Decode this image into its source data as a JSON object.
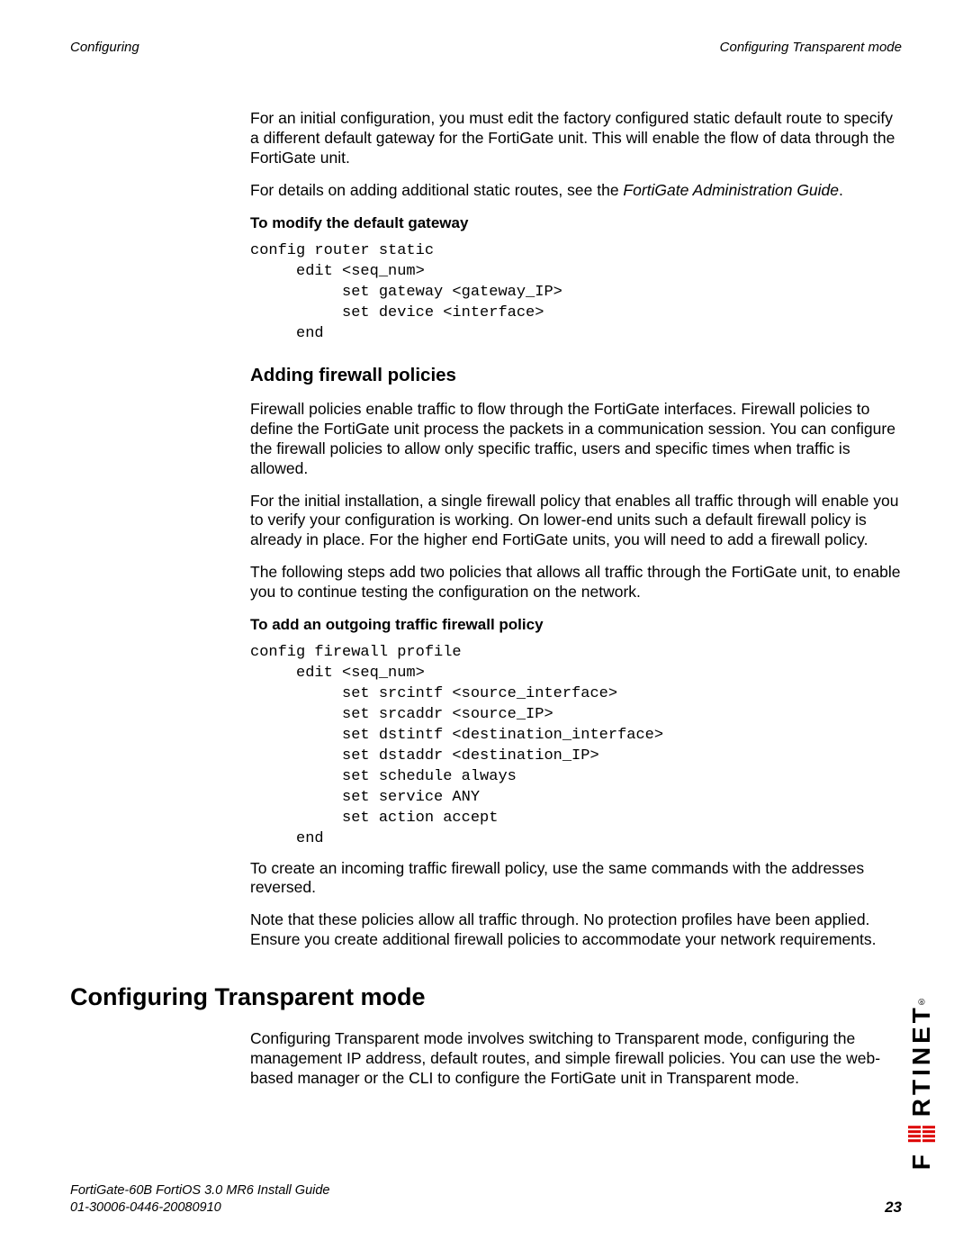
{
  "header": {
    "left": "Configuring",
    "right": "Configuring Transparent mode"
  },
  "intro": {
    "p1": "For an initial configuration, you must edit the factory configured static default route to specify a different default gateway for the FortiGate unit. This will enable the flow of data through the FortiGate unit.",
    "p2a": "For details on adding additional static routes, see the ",
    "p2b": "FortiGate Administration Guide",
    "p2c": "."
  },
  "gateway": {
    "heading": "To modify the default gateway",
    "code": "config router static\n     edit <seq_num>\n          set gateway <gateway_IP>\n          set device <interface>\n     end"
  },
  "firewall": {
    "title": "Adding firewall policies",
    "p1": "Firewall policies enable traffic to flow through the FortiGate interfaces. Firewall policies to define the FortiGate unit process the packets in a communication session. You can configure the firewall policies to allow only specific traffic, users and specific times when traffic is allowed.",
    "p2": "For the initial installation, a single firewall policy that enables all traffic through will enable you to verify your configuration is working. On lower-end units such a default firewall policy is already in place. For the higher end FortiGate units, you will need to add a firewall policy.",
    "p3": "The following steps add two policies that allows all traffic through the FortiGate unit, to enable you to continue testing the configuration on the network.",
    "sub_heading": "To add an outgoing traffic firewall policy",
    "code": "config firewall profile\n     edit <seq_num>\n          set srcintf <source_interface>\n          set srcaddr <source_IP>\n          set dstintf <destination_interface>\n          set dstaddr <destination_IP>\n          set schedule always\n          set service ANY\n          set action accept\n     end",
    "p4": "To create an incoming traffic firewall policy, use the same commands with the addresses reversed.",
    "p5": "Note that these policies allow all traffic through. No protection profiles have been applied. Ensure you create additional firewall policies to accommodate your network requirements."
  },
  "transparent": {
    "title": "Configuring Transparent mode",
    "p1": "Configuring Transparent mode involves switching to Transparent mode, configuring the management IP address, default routes, and simple firewall policies. You can use the web-based manager or the CLI to configure the FortiGate unit in Transparent mode."
  },
  "footer": {
    "line1": "FortiGate-60B FortiOS 3.0 MR6 Install Guide",
    "line2": "01-30006-0446-20080910",
    "page": "23"
  },
  "logo_text": "F    RTINET"
}
